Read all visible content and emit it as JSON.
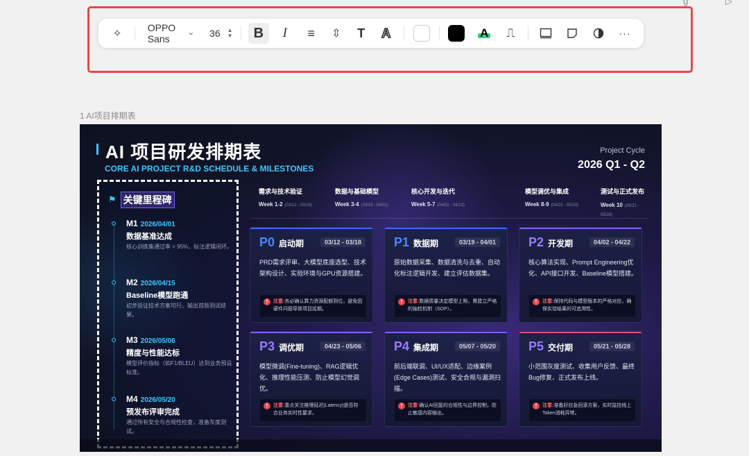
{
  "corner_fragments": {
    "a": "g",
    "b": "▷"
  },
  "toolbar": {
    "magic_icon": "✧",
    "font_family": "OPPO Sans",
    "font_family_chevron": "⌄",
    "font_size": "36",
    "bold_label": "B",
    "italic_label": "I",
    "align_icon": "≡",
    "line_height_icon": "⇳",
    "text_style_icon": "T",
    "text_outline_icon": "A",
    "highlight_label": "A",
    "format_painter_icon": "⎍",
    "more_icon": "···",
    "colors": {
      "fill_swatch": "#ffffff",
      "text_swatch": "#000000",
      "highlight": "#35d07f",
      "selection_border": "#e5484d"
    }
  },
  "canvas": {
    "page_label": "1 AI项目排期表"
  },
  "slide": {
    "title": "AI 项目研发排期表",
    "subtitle": "CORE AI PROJECT R&D SCHEDULE & MILESTONES",
    "cycle_label": "Project Cycle",
    "cycle_value": "2026 Q1 - Q2",
    "milestones": {
      "heading": "关键里程碑",
      "items": [
        {
          "code": "M1",
          "date": "2026/04/01",
          "name": "数据基准达成",
          "desc": "核心训练集通过率 > 95%，标注逻辑闭环。"
        },
        {
          "code": "M2",
          "date": "2026/04/15",
          "name": "Baseline模型跑通",
          "desc": "初步验证技术方案可行，输出首版测试结果。"
        },
        {
          "code": "M3",
          "date": "2026/05/06",
          "name": "精度与性能达标",
          "desc": "模型评价指标（如F1/BLEU）达到业务预设标准。"
        },
        {
          "code": "M4",
          "date": "2026/05/20",
          "name": "预发布评审完成",
          "desc": "通过所有安全与合规性检查，准备灰度测试。"
        }
      ]
    },
    "timeline": [
      {
        "name": "需求与技术验证",
        "week": "Week 1-2",
        "range": "(03/12 - 03/18)"
      },
      {
        "name": "数据与基础模型",
        "week": "Week 3-4",
        "range": "(03/19 - 04/01)"
      },
      {
        "name": "核心开发与迭代",
        "week": "Week 5-7",
        "range": "(04/02 - 04/22)"
      },
      {
        "name": "模型调优与集成",
        "week": "Week 8-9",
        "range": "(04/23 - 05/20)"
      },
      {
        "name": "测试与正式发布",
        "week": "Week 10",
        "range": "(05/21 - 05/28)"
      }
    ],
    "phases": [
      {
        "code": "P0",
        "name": "启动期",
        "range": "03/12 - 03/18",
        "desc": "PRD需求评审、大模型底座选型、技术架构设计、实验环境与GPU资源搭建。",
        "note_label": "注意:",
        "note": "务必确认算力资源配额到位，避免因硬件问题导致项目延期。"
      },
      {
        "code": "P1",
        "name": "数据期",
        "range": "03/19 - 04/01",
        "desc": "原始数据采集、数据清洗与去重、自动化标注逻辑开发、建立评估数据集。",
        "note_label": "注意:",
        "note": "数据质量决定模型上限，需建立严格的抽检机制（SOP）。"
      },
      {
        "code": "P2",
        "name": "开发期",
        "range": "04/02 - 04/22",
        "desc": "核心算法实现、Prompt Engineering优化、API接口开发、Baseline模型搭建。",
        "note_label": "注意:",
        "note": "保持代码与模型版本的严格对应，确保实验结果的可追溯性。"
      },
      {
        "code": "P3",
        "name": "调优期",
        "range": "04/23 - 05/06",
        "desc": "模型微调(Fine-tuning)、RAG逻辑优化、推理性能压测、防止模型幻觉调优。",
        "note_label": "注意:",
        "note": "重点关注推理延迟(Latency)是否符合业务实时性要求。"
      },
      {
        "code": "P4",
        "name": "集成期",
        "range": "05/07 - 05/20",
        "desc": "前后端联调、UI/UX适配、边缘案例(Edge Cases)测试、安全合规与漏洞扫描。",
        "note_label": "注意:",
        "note": "确认AI回复的合规性与边界控制，防止敏感内容输出。"
      },
      {
        "code": "P5",
        "name": "交付期",
        "range": "05/21 - 05/28",
        "desc": "小范围灰度测试、收集用户反馈、最终Bug修复、正式发布上线。",
        "note_label": "注意:",
        "note": "准备好应急回滚方案，实时监控线上Token消耗异常。"
      }
    ]
  }
}
